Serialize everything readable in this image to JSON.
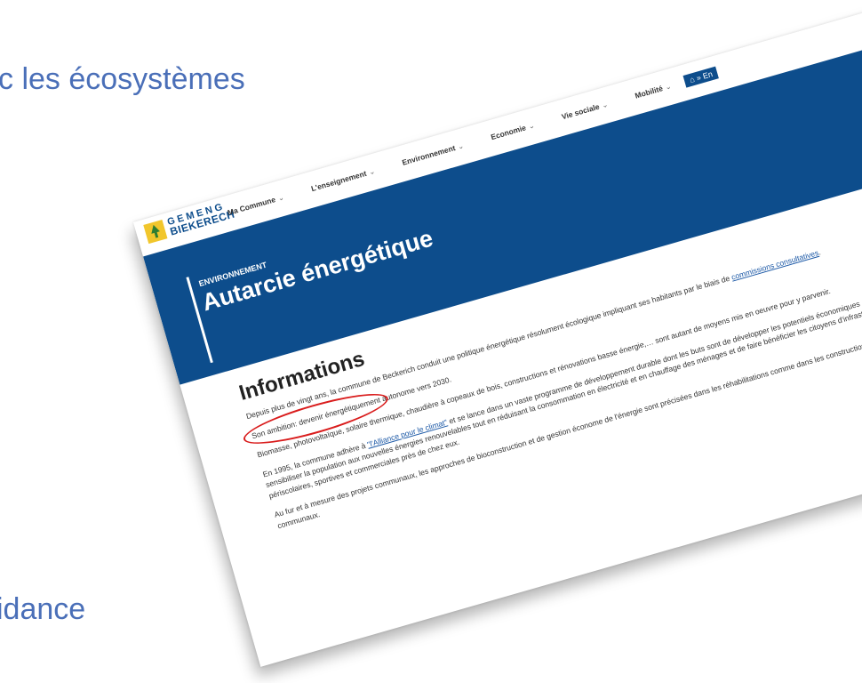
{
  "slide": {
    "top_text": "c les écosystèmes",
    "bottom_text": "idance"
  },
  "site": {
    "logo_line1": "GEMENG",
    "logo_line2": "BIEKERECH",
    "nav": [
      {
        "label": "Ma Commune"
      },
      {
        "label": "L'enseignement"
      },
      {
        "label": "Environnement"
      },
      {
        "label": "Economie"
      },
      {
        "label": "Vie sociale"
      },
      {
        "label": "Mobilité"
      }
    ],
    "breadcrumb": "» En",
    "hero": {
      "kicker": "ENVIRONNEMENT",
      "title": "Autarcie énergétique"
    },
    "content": {
      "heading": "Informations",
      "p1_pre": "Depuis plus de vingt ans, la commune de Beckerich conduit une politique énergétique résolument écologique impliquant ses habitants par le biais de ",
      "p1_link": "commissions consultatives",
      "p1_post": ".",
      "p2": "Son ambition: devenir énergétiquement autonome vers 2030.",
      "p3": "Biomasse, photovoltaïque, solaire thermique, chaudière à copeaux de bois, constructions et rénovations basse énergie,… sont autant de moyens mis en oeuvre pour y parvenir.",
      "p4_pre": "En 1995, la commune adhère à ",
      "p4_link": "\"l'Alliance pour le climat\"",
      "p4_post": " et se lance dans un vaste programme de développement durable dont les buts sont de développer les potentiels économiques de la région, de sensibiliser la population aux nouvelles énergies renouvelables tout en réduisant la consommation en électricité et en chauffage des ménages et de faire bénéficier les citoyens d'infrastructures scolaires, périscolaires, sportives et commerciales près de chez eux.",
      "p5": "Au fur et à mesure des projets communaux, les approches de bioconstruction et de gestion économe de l'énergie sont précisées dans les réhabilitations comme dans les constructions de nombreux bâtiments communaux."
    }
  },
  "colors": {
    "accent_blue": "#0d4d8c",
    "slide_text": "#4a6fb8",
    "highlight_red": "#d91c1c"
  }
}
